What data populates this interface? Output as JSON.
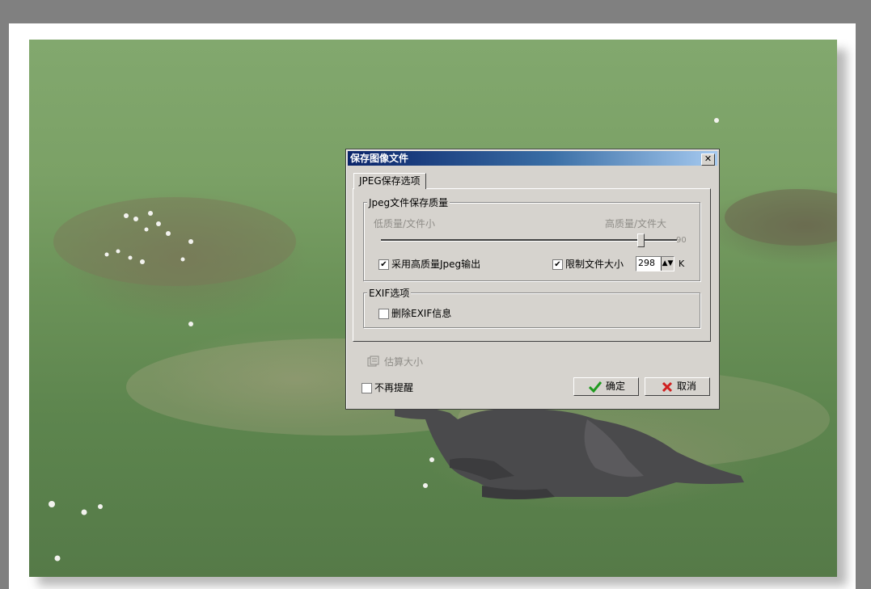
{
  "dialog": {
    "title": "保存图像文件",
    "close_glyph": "✕",
    "tab_label": "JPEG保存选项",
    "quality_group": {
      "label": "Jpeg文件保存质量",
      "low_label": "低质量/文件小",
      "high_label": "高质量/文件大",
      "quality_value": 90,
      "quality_text": "90",
      "high_quality_label": "采用高质量Jpeg输出",
      "high_quality_checked": true,
      "limit_size_label": "限制文件大小",
      "limit_size_checked": true,
      "size_value": "298",
      "size_unit": "K"
    },
    "exif_group": {
      "label": "EXIF选项",
      "remove_exif_label": "删除EXIF信息",
      "remove_exif_checked": false
    },
    "estimate_label": "估算大小",
    "no_remind_label": "不再提醒",
    "no_remind_checked": false,
    "ok_label": "确定",
    "cancel_label": "取消",
    "check_glyph": "✔"
  },
  "colors": {
    "dialog_bg": "#d6d3ce",
    "title_start": "#0a246a",
    "title_end": "#a6caf0",
    "ok_icon": "#1f9a1f",
    "cancel_icon": "#d02020"
  },
  "icons": {
    "close": "close-icon",
    "estimate": "calculator-icon",
    "ok": "checkmark-icon",
    "cancel": "x-icon"
  }
}
